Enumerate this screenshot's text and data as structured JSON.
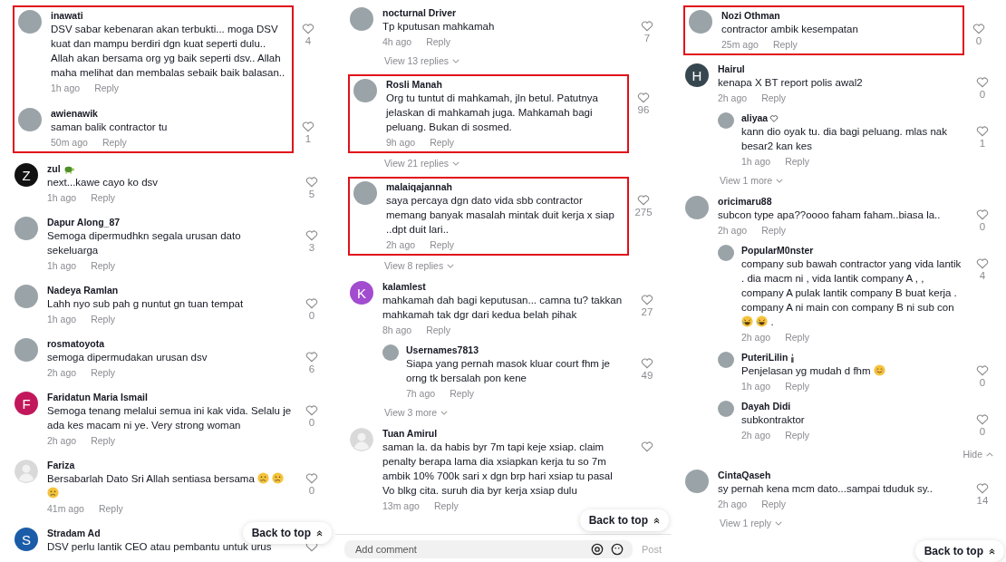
{
  "columns": [
    {
      "items": [
        {
          "kind": "group",
          "highlighted": true,
          "items": [
            {
              "kind": "comment",
              "user": "inawati",
              "avatar": {
                "kind": "photo"
              },
              "text": "DSV sabar kebenaran akan terbukti... moga DSV kuat dan mampu berdiri dgn kuat seperti dulu.. Allah akan bersama org yg baik seperti dsv.. Allah maha melihat dan membalas sebaik baik balasan..",
              "time": "1h ago",
              "reply": "Reply",
              "likes": "4"
            },
            {
              "kind": "comment",
              "user": "awienawik",
              "avatar": {
                "kind": "photo"
              },
              "text": "saman balik contractor tu",
              "time": "50m ago",
              "reply": "Reply",
              "likes": "1"
            }
          ]
        },
        {
          "kind": "comment",
          "user": "zul",
          "name_badge": {
            "kind": "turtle"
          },
          "avatar": {
            "kind": "letter",
            "letter": "Z",
            "color": "#111111"
          },
          "text": "next...kawe cayo ko dsv",
          "time": "1h ago",
          "reply": "Reply",
          "likes": "5"
        },
        {
          "kind": "comment",
          "user": "Dapur Along_87",
          "avatar": {
            "kind": "photo"
          },
          "text": "Semoga dipermudhkn segala urusan dato sekeluarga",
          "time": "1h ago",
          "reply": "Reply",
          "likes": "3"
        },
        {
          "kind": "comment",
          "user": "Nadeya Ramlan",
          "avatar": {
            "kind": "photo"
          },
          "text": "Lahh nyo sub pah g nuntut gn tuan tempat",
          "time": "1h ago",
          "reply": "Reply",
          "likes": "0"
        },
        {
          "kind": "comment",
          "user": "rosmatoyota",
          "avatar": {
            "kind": "photo"
          },
          "text": "semoga dipermudakan urusan dsv",
          "time": "2h ago",
          "reply": "Reply",
          "likes": "6"
        },
        {
          "kind": "comment",
          "user": "Faridatun Maria Ismail",
          "avatar": {
            "kind": "letter",
            "letter": "F",
            "color": "#c2185b"
          },
          "text": "Semoga tenang melalui semua ini kak vida. Selalu je ada kes macam ni ye. Very strong woman",
          "time": "2h ago",
          "reply": "Reply",
          "likes": "0"
        },
        {
          "kind": "comment",
          "user": "Fariza",
          "avatar": {
            "kind": "default"
          },
          "text": "Bersabarlah Dato Sri Allah sentiasa bersama",
          "emojis": [
            {
              "kind": "crying"
            },
            {
              "kind": "crying"
            },
            {
              "kind": "crying"
            }
          ],
          "time": "41m ago",
          "reply": "Reply",
          "likes": "0"
        },
        {
          "kind": "comment",
          "user": "Stradam Ad",
          "avatar": {
            "kind": "letter",
            "letter": "S",
            "color": "#1a5ca8"
          },
          "text": "DSV perlu lantik CEO atau pembantu untuk urus"
        }
      ],
      "back_to_top": "Back to top"
    },
    {
      "items": [
        {
          "kind": "comment",
          "user": "nocturnal Driver",
          "avatar": {
            "kind": "photo"
          },
          "text": "Tp kputusan mahkamah",
          "time": "4h ago",
          "reply": "Reply",
          "likes": "7"
        },
        {
          "kind": "more",
          "label": "View 13 replies",
          "expanded": false
        },
        {
          "kind": "group",
          "highlighted": true,
          "items": [
            {
              "kind": "comment",
              "user": "Rosli Manah",
              "avatar": {
                "kind": "photo"
              },
              "text": "Org tu tuntut di mahkamah, jln betul. Patutnya jelaskan di mahkamah juga. Mahkamah bagi peluang. Bukan di sosmed.",
              "time": "9h ago",
              "reply": "Reply",
              "likes": "96"
            }
          ]
        },
        {
          "kind": "more",
          "label": "View 21 replies",
          "expanded": false
        },
        {
          "kind": "group",
          "highlighted": true,
          "items": [
            {
              "kind": "comment",
              "user": "malaiqajannah",
              "avatar": {
                "kind": "photo"
              },
              "text": "saya percaya dgn dato vida sbb contractor memang banyak masalah mintak duit kerja x siap ..dpt duit lari..",
              "time": "2h ago",
              "reply": "Reply",
              "likes": "275"
            }
          ]
        },
        {
          "kind": "more",
          "label": "View 8 replies",
          "expanded": false
        },
        {
          "kind": "comment",
          "user": "kalamlest",
          "avatar": {
            "kind": "letter",
            "letter": "K",
            "color": "#a24ccf"
          },
          "text": "mahkamah dah bagi keputusan... camna tu? takkan mahkamah tak dgr dari kedua belah pihak",
          "time": "8h ago",
          "reply": "Reply",
          "likes": "27"
        },
        {
          "kind": "reply",
          "user": "Usernames7813",
          "avatar": {
            "kind": "photo"
          },
          "text": "Siapa yang pernah masok kluar court fhm je orng tk bersalah pon kene",
          "time": "7h ago",
          "reply": "Reply",
          "likes": "49"
        },
        {
          "kind": "more",
          "label": "View 3 more",
          "expanded": false
        },
        {
          "kind": "comment",
          "user": "Tuan Amirul",
          "avatar": {
            "kind": "default"
          },
          "text": "saman la. da habis byr 7m tapi keje xsiap. claim penalty berapa lama dia xsiapkan kerja tu so 7m ambik 10% 700k sari x dgn brp hari xsiap tu pasal Vo blkg cita. suruh dia byr kerja xsiap dulu",
          "time": "13m ago",
          "reply": "Reply"
        }
      ],
      "back_to_top": "Back to top",
      "comment_box": {
        "placeholder": "Add comment",
        "post": "Post",
        "post_disabled": true
      }
    },
    {
      "items": [
        {
          "kind": "group",
          "highlighted": true,
          "items": [
            {
              "kind": "comment",
              "user": "Nozi Othman",
              "avatar": {
                "kind": "photo"
              },
              "text": "contractor ambik kesempatan",
              "time": "25m ago",
              "reply": "Reply",
              "likes": "0"
            }
          ]
        },
        {
          "kind": "comment",
          "user": "Hairul",
          "avatar": {
            "kind": "letter",
            "letter": "H",
            "color": "#37474f"
          },
          "text": "kenapa X BT report polis awal2",
          "time": "2h ago",
          "reply": "Reply",
          "likes": "0"
        },
        {
          "kind": "reply",
          "user": "aliyaa",
          "name_badge": {
            "kind": "heart"
          },
          "avatar": {
            "kind": "photo"
          },
          "text": "kann dio oyak tu. dia bagi peluang. mlas nak besar2 kan kes",
          "time": "1h ago",
          "reply": "Reply",
          "likes": "1"
        },
        {
          "kind": "more",
          "label": "View 1 more",
          "expanded": false
        },
        {
          "kind": "comment",
          "user": "oricimaru88",
          "avatar": {
            "kind": "photo"
          },
          "text": "subcon type apa??oooo faham faham..biasa la..",
          "time": "2h ago",
          "reply": "Reply",
          "likes": "0"
        },
        {
          "kind": "reply",
          "user": "PopularM0nster",
          "avatar": {
            "kind": "photo"
          },
          "text": "company sub bawah contractor yang vida lantik . dia macm ni , vida lantik company A , , company A pulak lantik company B buat kerja . company A ni main con company B ni sub con",
          "emojis": [
            {
              "kind": "laughing"
            },
            {
              "kind": "laughing"
            }
          ],
          "text_end": ".",
          "time": "2h ago",
          "reply": "Reply",
          "likes": "4"
        },
        {
          "kind": "reply",
          "user": "PuteriLilin",
          "name_badge": {
            "kind": "candle"
          },
          "avatar": {
            "kind": "photo"
          },
          "text": "Penjelasan yg mudah d fhm",
          "emojis": [
            {
              "kind": "smiling"
            }
          ],
          "time": "1h ago",
          "reply": "Reply",
          "likes": "0"
        },
        {
          "kind": "reply",
          "user": "Dayah Didi",
          "avatar": {
            "kind": "photo"
          },
          "text": "subkontraktor",
          "time": "2h ago",
          "reply": "Reply",
          "likes": "0"
        },
        {
          "kind": "more",
          "label": "Hide",
          "expanded": true
        },
        {
          "kind": "comment",
          "user": "CintaQaseh",
          "avatar": {
            "kind": "photo"
          },
          "text": "sy pernah kena mcm dato...sampai tduduk sy..",
          "time": "2h ago",
          "reply": "Reply",
          "likes": "14"
        },
        {
          "kind": "more",
          "label": "View 1 reply",
          "expanded": false
        }
      ],
      "back_to_top": "Back to top"
    }
  ]
}
